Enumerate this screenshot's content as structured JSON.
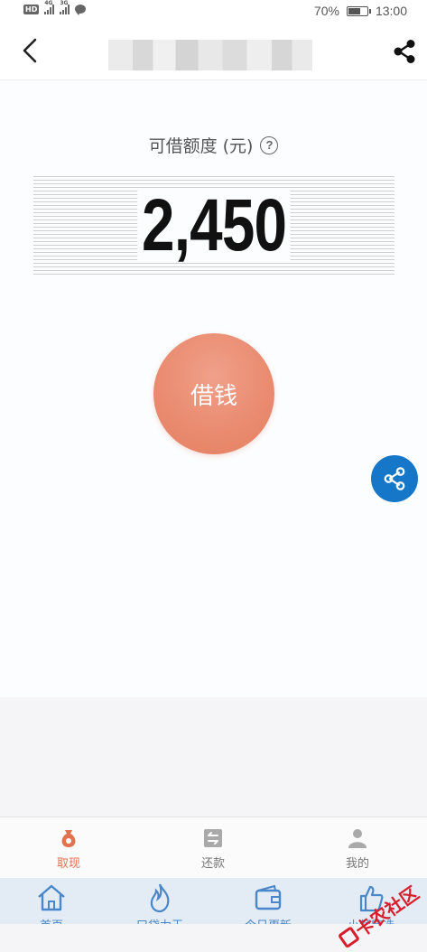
{
  "status_bar": {
    "hd_label": "HD",
    "net1": "4G",
    "net2": "3G",
    "battery_percent": "70%",
    "battery_level": 0.7,
    "time": "13:00"
  },
  "nav": {
    "back_icon": "chevron-left-icon",
    "share_icon": "share-icon"
  },
  "credit": {
    "label": "可借额度 (元)",
    "help_icon": "question-icon",
    "amount": "2,450"
  },
  "borrow_button": {
    "label": "借钱"
  },
  "tabs": [
    {
      "label": "取现",
      "icon": "money-bag-icon",
      "active": true
    },
    {
      "label": "还款",
      "icon": "repay-icon",
      "active": false
    },
    {
      "label": "我的",
      "icon": "user-icon",
      "active": false
    }
  ],
  "colors": {
    "accent": "#e98a6e",
    "share_blue": "#1677c9",
    "active_tab": "#e2734e",
    "lower_nav": "#4a87c8"
  },
  "lower_nav": [
    {
      "label": "首页",
      "icon": "home-icon"
    },
    {
      "label": "口贷力王",
      "icon": "fire-icon"
    },
    {
      "label": "今日更新",
      "icon": "wallet-icon"
    },
    {
      "label": "小额精选",
      "icon": "thumbs-up-icon"
    }
  ],
  "watermark": {
    "text": "卡农社区"
  }
}
